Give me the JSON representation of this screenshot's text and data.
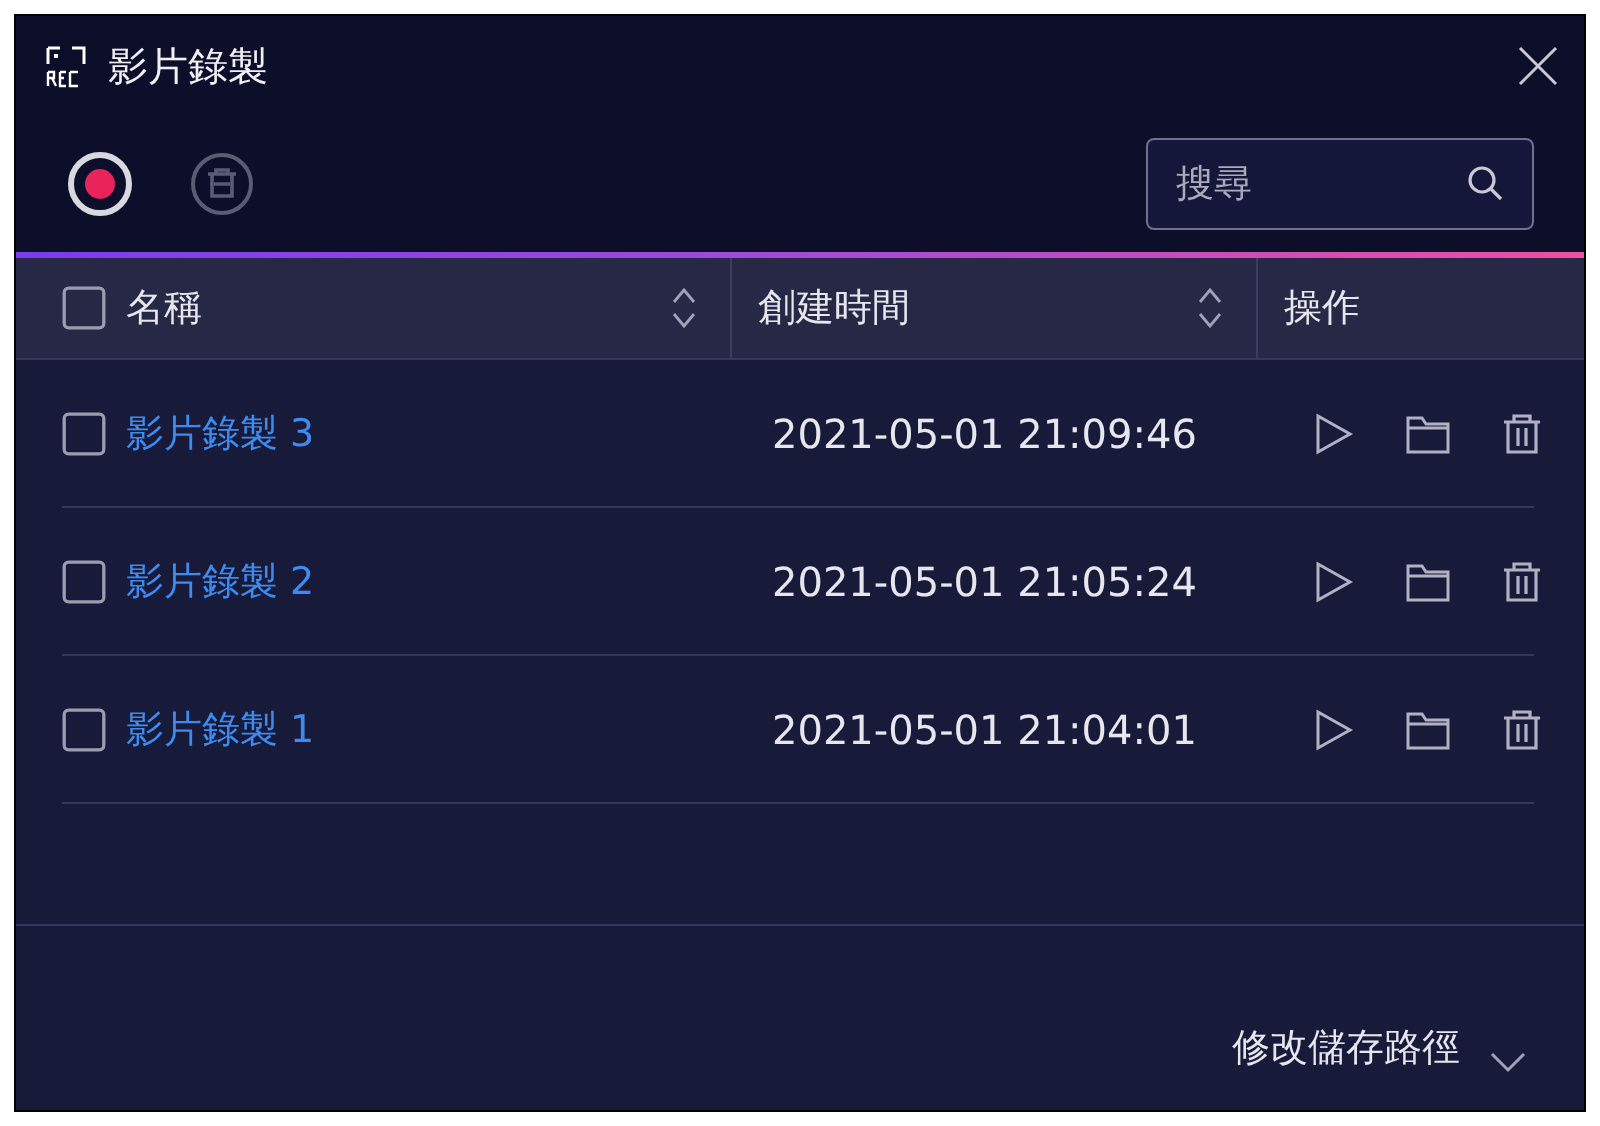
{
  "window": {
    "title": "影片錄製"
  },
  "toolbar": {
    "search": {
      "placeholder": "搜尋"
    }
  },
  "table": {
    "select_all": {
      "checked": false
    },
    "columns": [
      {
        "label": "名稱",
        "sortable": true
      },
      {
        "label": "創建時間",
        "sortable": true
      },
      {
        "label": "操作",
        "sortable": false
      }
    ],
    "rows": [
      {
        "name": "影片錄製 3",
        "created": "2021-05-01 21:09:46",
        "checked": false
      },
      {
        "name": "影片錄製 2",
        "created": "2021-05-01 21:05:24",
        "checked": false
      },
      {
        "name": "影片錄製 1",
        "created": "2021-05-01 21:04:01",
        "checked": false
      }
    ]
  },
  "footer": {
    "label": "修改儲存路徑"
  }
}
